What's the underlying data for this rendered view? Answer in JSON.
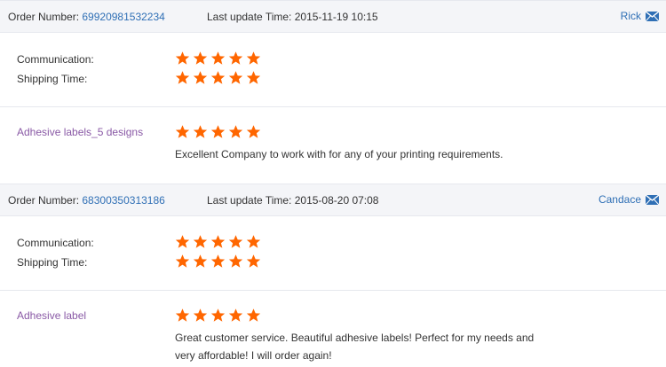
{
  "colors": {
    "link": "#2f6fb5",
    "star": "#ff6600",
    "product": "#8a5aa6",
    "header_bg": "#f4f5f8"
  },
  "orders": [
    {
      "order_label": "Order Number:",
      "order_number": "69920981532234",
      "update_label": "Last update Time:",
      "update_time": "2015-11-19 10:15",
      "buyer": "Rick",
      "ratings": [
        {
          "label": "Communication:",
          "stars": 5
        },
        {
          "label": "Shipping Time:",
          "stars": 5
        }
      ],
      "product": "Adhesive labels_5 designs",
      "product_stars": 5,
      "review": "Excellent Company to work with for any of your printing requirements."
    },
    {
      "order_label": "Order Number:",
      "order_number": "68300350313186",
      "update_label": "Last update Time:",
      "update_time": "2015-08-20 07:08",
      "buyer": "Candace",
      "ratings": [
        {
          "label": "Communication:",
          "stars": 5
        },
        {
          "label": "Shipping Time:",
          "stars": 5
        }
      ],
      "product": "Adhesive label",
      "product_stars": 5,
      "review": "Great customer service. Beautiful adhesive labels! Perfect for my needs and very affordable! I will order again!"
    }
  ]
}
